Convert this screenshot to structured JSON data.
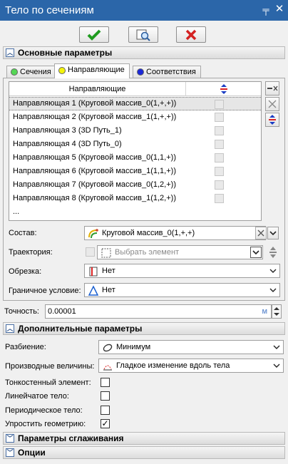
{
  "window": {
    "title": "Тело по сечениям",
    "pin_glyph": "╤",
    "close_glyph": "✕"
  },
  "toolbar": {
    "ok_icon": "checkmark-icon",
    "preview_icon": "preview-icon",
    "cancel_icon": "cancel-icon"
  },
  "sections": {
    "main": "Основные параметры",
    "additional": "Дополнительные параметры",
    "smoothing": "Параметры сглаживания",
    "options": "Опции"
  },
  "tabs": [
    {
      "label": "Сечения",
      "color": "#55d755"
    },
    {
      "label": "Направляющие",
      "color": "#f4f40c"
    },
    {
      "label": "Соответствия",
      "color": "#1b28d8"
    }
  ],
  "guides_list": {
    "header": "Направляющие",
    "rows": [
      "Направляющая 1 (Круговой массив_0(1,+,+))",
      "Направляющая 2 (Круговой массив_1(1,+,+))",
      "Направляющая 3 (3D Путь_1)",
      "Направляющая 4 (3D Путь_0)",
      "Направляющая 5 (Круговой массив_0(1,1,+))",
      "Направляющая 6 (Круговой массив_1(1,1,+))",
      "Направляющая 7 (Круговой массив_0(1,2,+))",
      "Направляющая 8 (Круговой массив_1(1,2,+))"
    ],
    "ellipsis": "..."
  },
  "fields": {
    "composition_label": "Состав:",
    "composition_value": "Круговой массив_0(1,+,+)",
    "trajectory_label": "Траектория:",
    "trajectory_placeholder": "Выбрать элемент",
    "trim_label": "Обрезка:",
    "trim_value": "Нет",
    "boundary_label": "Граничное условие:",
    "boundary_value": "Нет",
    "accuracy_label": "Точность:",
    "accuracy_value": "0.00001",
    "accuracy_unit": "м"
  },
  "additional": {
    "partition_label": "Разбиение:",
    "partition_value": "Минимум",
    "derivatives_label": "Производные величины:",
    "derivatives_value": "Гладкое изменение вдоль тела",
    "thin_label": "Тонкостенный элемент:",
    "ruled_label": "Линейчатое тело:",
    "periodic_label": "Периодическое тело:",
    "simplify_label": "Упростить геометрию:",
    "simplify_mark": "✓"
  }
}
